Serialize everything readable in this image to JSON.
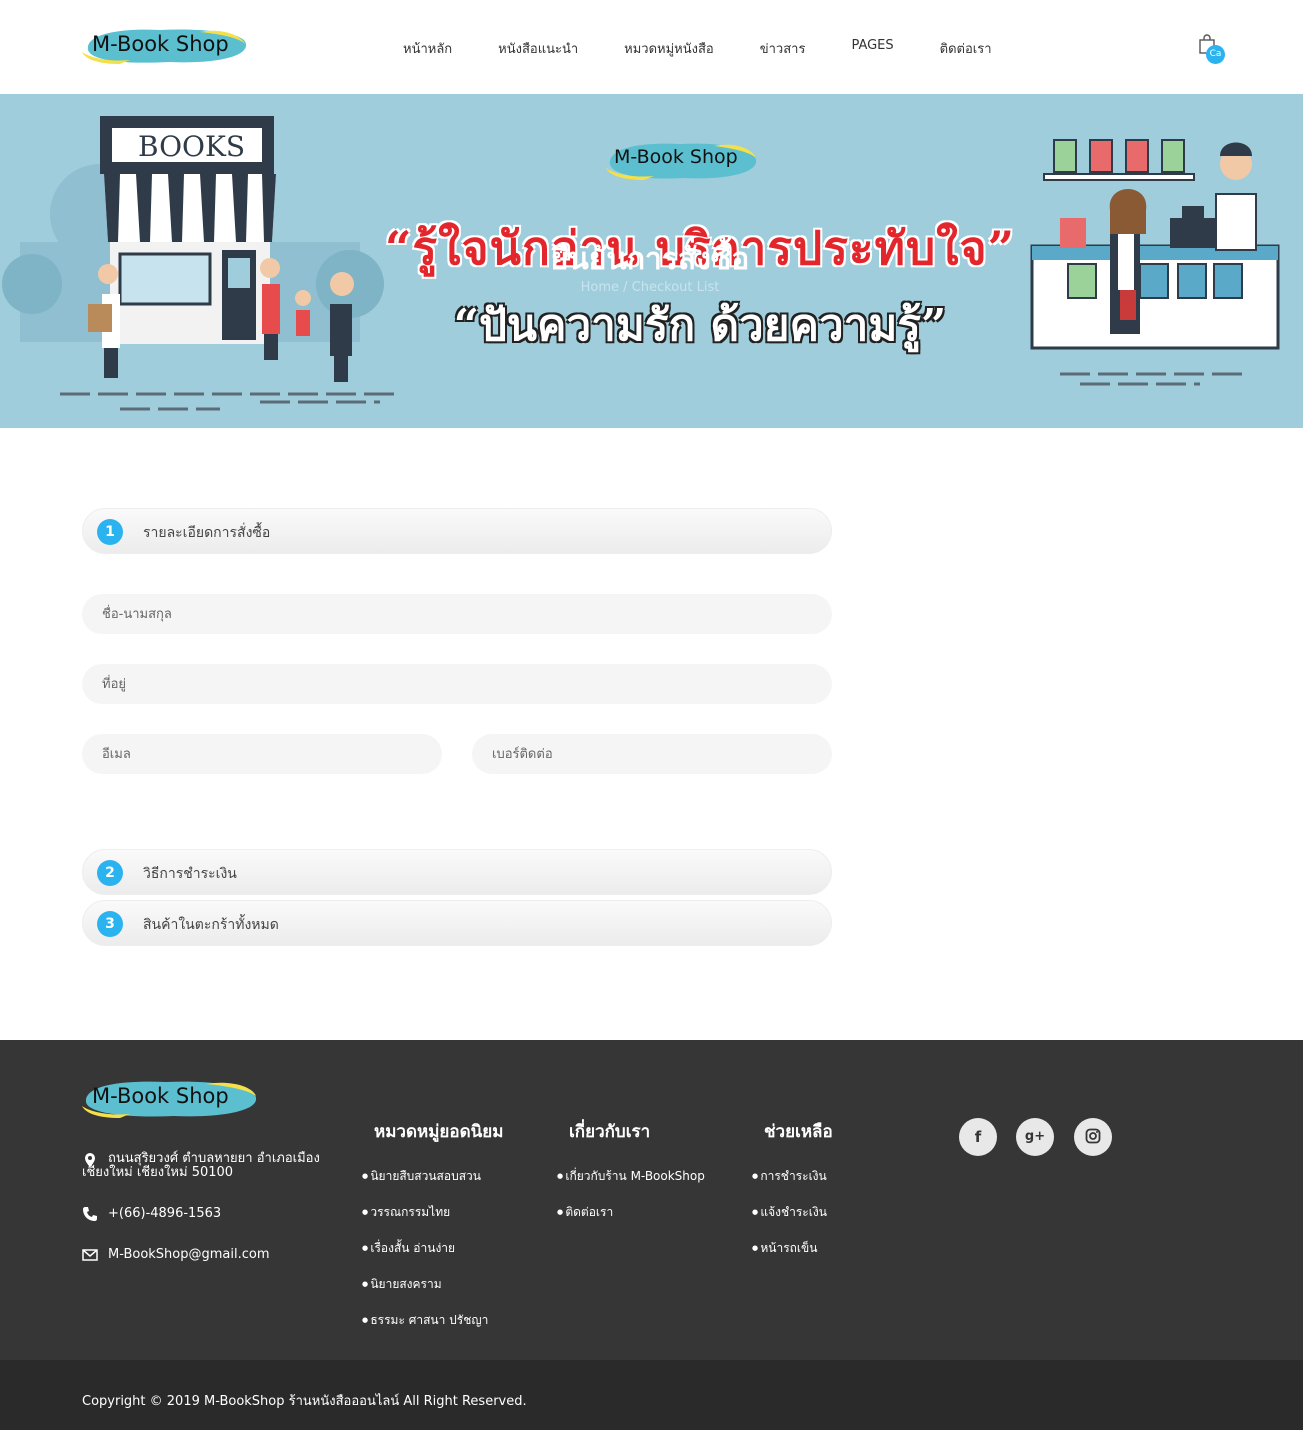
{
  "header": {
    "logo_text": "M-Book Shop",
    "nav": [
      "หน้าหลัก",
      "หนังสือแนะนำ",
      "หมวดหมู่หนังสือ",
      "ข่าวสาร",
      "PAGES",
      "ติดต่อเรา"
    ],
    "cart_badge": "Ca"
  },
  "banner": {
    "logo_text": "M-Book Shop",
    "store_sign": "BOOKS",
    "slogan_top": "“รู้ใจนักอ่าน บริการประทับใจ”",
    "heading": "ยืนยันการสั่งซื้อ",
    "breadcrumb": "Home / Checkout List",
    "slogan_bottom": "“ปันความรัก ด้วยความรู้”"
  },
  "checkout": {
    "step1": {
      "num": "1",
      "label": "รายละเอียดการสั่งซื้อ"
    },
    "fields": {
      "name": "ชื่อ-นามสกุล",
      "address": "ที่อยู่",
      "email": "อีเมล",
      "phone": "เบอร์ติดต่อ"
    },
    "step2": {
      "num": "2",
      "label": "วิธีการชำระเงิน"
    },
    "step3": {
      "num": "3",
      "label": "สินค้าในตะกร้าทั้งหมด"
    }
  },
  "footer": {
    "logo_text": "M-Book Shop",
    "address": "ถนนสุริยวงศ์ ตำบลหายยา อำเภอเมืองเชียงใหม่ เชียงใหม่ 50100",
    "phone": "+(66)-4896-1563",
    "email": "M-BookShop@gmail.com",
    "col1": {
      "title": "หมวดหมู่ยอดนิยม",
      "items": [
        "นิยายสืบสวนสอบสวน",
        "วรรณกรรมไทย",
        "เรื่องสั้น อ่านง่าย",
        "นิยายสงคราม",
        "ธรรมะ ศาสนา ปรัชญา"
      ]
    },
    "col2": {
      "title": "เกี่ยวกับเรา",
      "items": [
        "เกี่ยวกับร้าน M-BookShop",
        "ติดต่อเรา"
      ]
    },
    "col3": {
      "title": "ช่วยเหลือ",
      "items": [
        "การชำระเงิน",
        "แจ้งชำระเงิน",
        "หน้ารถเข็น"
      ]
    },
    "social": [
      "facebook-icon",
      "google-plus-icon",
      "instagram-icon"
    ]
  },
  "copyright": "Copyright © 2019 M-BookShop ร้านหนังสือออนไลน์ All Right Reserved.",
  "colors": {
    "accent": "#2bb3f0",
    "banner": "#9fcddc",
    "footer": "#363636",
    "slogan_red": "#e3262c"
  }
}
